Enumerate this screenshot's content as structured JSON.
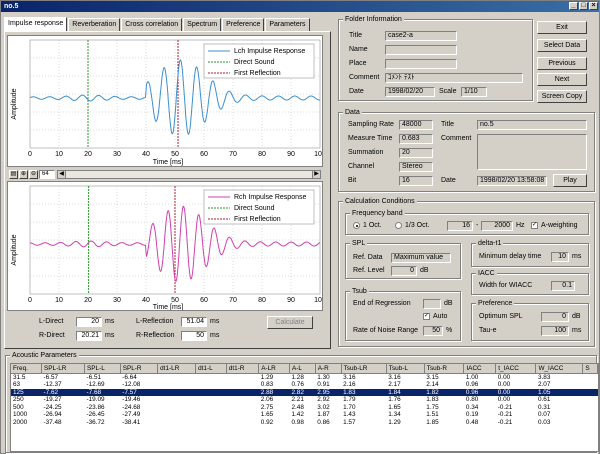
{
  "window": {
    "title": "no.5"
  },
  "tabs": [
    {
      "label": "Impulse response",
      "active": true
    },
    {
      "label": "Reverberation",
      "active": false
    },
    {
      "label": "Cross correlation",
      "active": false
    },
    {
      "label": "Spectrum",
      "active": false
    },
    {
      "label": "Preference",
      "active": false
    },
    {
      "label": "Parameters",
      "active": false
    }
  ],
  "plot_top": {
    "ylabel": "Amplitude",
    "xlabel": "Time [ms]",
    "x_ticks": [
      "0",
      "10",
      "20",
      "30",
      "40",
      "50",
      "60",
      "70",
      "80",
      "90",
      "100"
    ],
    "legend": [
      "Lch Impulse Response",
      "Direct Sound",
      "First Reflection"
    ],
    "color": "#3c8fd0"
  },
  "plot_bottom": {
    "ylabel": "Amplitude",
    "xlabel": "Time [ms]",
    "x_ticks": [
      "0",
      "10",
      "20",
      "30",
      "40",
      "50",
      "60",
      "70",
      "80",
      "90",
      "100"
    ],
    "legend": [
      "Rch Impulse Response",
      "Direct Sound",
      "First Reflection"
    ],
    "color": "#d040b0"
  },
  "plot_colors": {
    "direct": "#2a9a2a",
    "reflection": "#b02030"
  },
  "toolbar": {
    "zoom_value": "64"
  },
  "measure": {
    "l_direct_label": "L-Direct",
    "l_direct": "20",
    "l_direct_unit": "ms",
    "r_direct_label": "R-Direct",
    "r_direct": "20.21",
    "r_direct_unit": "ms",
    "l_refl_label": "L-Reflection",
    "l_refl": "51.04",
    "l_refl_unit": "ms",
    "r_refl_label": "R-Reflection",
    "r_refl": "50",
    "r_refl_unit": "ms",
    "calculate": "Calculate"
  },
  "folder": {
    "title": "Folder Information",
    "title_label": "Title",
    "title_value": "case2-a",
    "name_label": "Name",
    "place_label": "Place",
    "comment_label": "Comment",
    "comment_value": "ｺﾒﾝﾄ ﾃｽﾄ",
    "date_label": "Date",
    "date_value": "1998/02/20",
    "scale_label": "Scale",
    "scale_value": "1/10"
  },
  "buttons": {
    "exit": "Exit",
    "select_data": "Select Data",
    "previous": "Previous",
    "next": "Next",
    "screen_copy": "Screen Copy"
  },
  "data_box": {
    "title": "Data",
    "sampling_rate_label": "Sampling Rate",
    "sampling_rate": "48000",
    "measure_time_label": "Measure Time",
    "measure_time": "0.683",
    "summation_label": "Summation",
    "summation": "20",
    "channel_label": "Channel",
    "channel": "Stereo",
    "bit_label": "Bit",
    "bit": "16",
    "title_label": "Title",
    "title_value": "no.5",
    "comment_label": "Comment",
    "date_label": "Date",
    "date_value": "1998/02/20 13:58:08",
    "play": "Play"
  },
  "calc": {
    "title": "Calculation Conditions",
    "freq_band_title": "Frequency band",
    "oct_1": "1 Oct.",
    "oct_3": "1/3 Oct.",
    "freq_from": "16",
    "freq_to": "2000",
    "hz": "Hz",
    "a_weight": "A-weighting",
    "spl_title": "SPL",
    "ref_data_label": "Ref. Data",
    "ref_data": "Maximum value",
    "ref_level_label": "Ref. Level",
    "ref_level": "0",
    "db": "dB",
    "tsub_title": "Tsub",
    "end_reg_label": "End of Regression",
    "tsub_db": "dB",
    "auto_label": "Auto",
    "noise_label": "Rate of Noise Range",
    "noise_value": "50",
    "pct": "%",
    "delta_title": "delta-t1",
    "min_delay_label": "Minimum delay time",
    "min_delay": "10",
    "ms": "ms",
    "iacc_title": "IACC",
    "wiacc_label": "Width for WIACC",
    "wiacc": "0.1",
    "pref_title": "Preference",
    "opt_spl_label": "Optimum SPL",
    "opt_spl": "0",
    "opt_db": "dB",
    "taue_label": "Tau-e",
    "taue": "100",
    "taue_ms": "ms"
  },
  "acoustic": {
    "title": "Acoustic Parameters",
    "columns": [
      "Freq.",
      "SPL-LR",
      "SPL-L",
      "SPL-R",
      "dt1-LR",
      "dt1-L",
      "dt1-R",
      "A-LR",
      "A-L",
      "A-R",
      "Tsub-LR",
      "Tsub-L",
      "Tsub-R",
      "IACC",
      "t_IACC",
      "W_IACC",
      "S"
    ],
    "rows": [
      [
        "31.5",
        "-6.57",
        "-6.51",
        "-6.64",
        "",
        "",
        "",
        "1.29",
        "1.28",
        "1.30",
        "3.16",
        "3.16",
        "3.15",
        "1.00",
        "0.00",
        "3.83",
        ""
      ],
      [
        "63",
        "-12.37",
        "-12.69",
        "-12.08",
        "",
        "",
        "",
        "0.83",
        "0.76",
        "0.91",
        "2.16",
        "2.17",
        "2.14",
        "0.96",
        "0.00",
        "2.07",
        ""
      ],
      [
        "125",
        "-7.62",
        "-7.68",
        "-7.57",
        "",
        "",
        "",
        "2.88",
        "2.82",
        "2.95",
        "1.83",
        "1.84",
        "1.82",
        "0.96",
        "0.00",
        "1.05",
        ""
      ],
      [
        "250",
        "-19.27",
        "-19.09",
        "-19.46",
        "",
        "",
        "",
        "2.06",
        "2.21",
        "2.92",
        "1.79",
        "1.76",
        "1.83",
        "0.80",
        "0.00",
        "0.61",
        ""
      ],
      [
        "500",
        "-24.25",
        "-23.86",
        "-24.68",
        "",
        "",
        "",
        "2.75",
        "2.48",
        "3.02",
        "1.70",
        "1.65",
        "1.75",
        "0.34",
        "-0.21",
        "0.31",
        ""
      ],
      [
        "1000",
        "-26.94",
        "-26.45",
        "-27.49",
        "",
        "",
        "",
        "1.65",
        "1.42",
        "1.87",
        "1.43",
        "1.34",
        "1.51",
        "0.19",
        "-0.21",
        "0.07",
        ""
      ],
      [
        "2000",
        "-37.48",
        "-36.72",
        "-38.41",
        "",
        "",
        "",
        "0.92",
        "0.98",
        "0.86",
        "1.57",
        "1.29",
        "1.85",
        "0.48",
        "-0.21",
        "0.03",
        ""
      ]
    ],
    "selected_row": 2
  }
}
